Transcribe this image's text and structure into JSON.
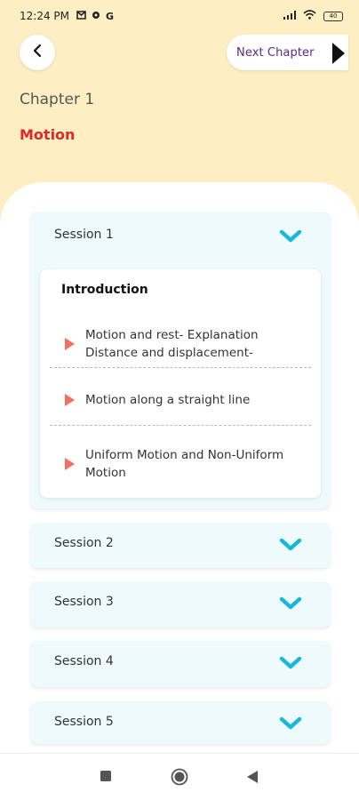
{
  "status_bar": {
    "time": "12:24 PM",
    "left_icons": [
      "mail-icon",
      "settings-icon",
      "google-icon"
    ],
    "right_icons": [
      "signal-icon",
      "wifi-icon"
    ],
    "battery": "40"
  },
  "header": {
    "back_icon": "chevron-left-icon",
    "next_chapter_label": "Next Chapter",
    "next_icon": "play-right-icon",
    "chapter_number": "Chapter 1",
    "chapter_title": "Motion"
  },
  "sessions": [
    {
      "label": "Session 1",
      "expanded": true,
      "section_title": "Introduction",
      "topics": [
        "Motion and rest- Explanation Distance and displacement-",
        "Motion along a straight line",
        "Uniform Motion and Non-Uniform Motion"
      ]
    },
    {
      "label": "Session 2",
      "expanded": false
    },
    {
      "label": "Session 3",
      "expanded": false
    },
    {
      "label": "Session 4",
      "expanded": false
    },
    {
      "label": "Session 5",
      "expanded": false
    }
  ],
  "colors": {
    "header_bg": "#fdefc3",
    "chapter_title": "#e02828",
    "session_bg": "#eefafc",
    "chevron": "#19b8d8",
    "play": "#f07062",
    "next_label": "#5a2a7a"
  },
  "nav_bar": {
    "icons": [
      "recent-apps-icon",
      "home-icon",
      "back-triangle-icon"
    ]
  }
}
